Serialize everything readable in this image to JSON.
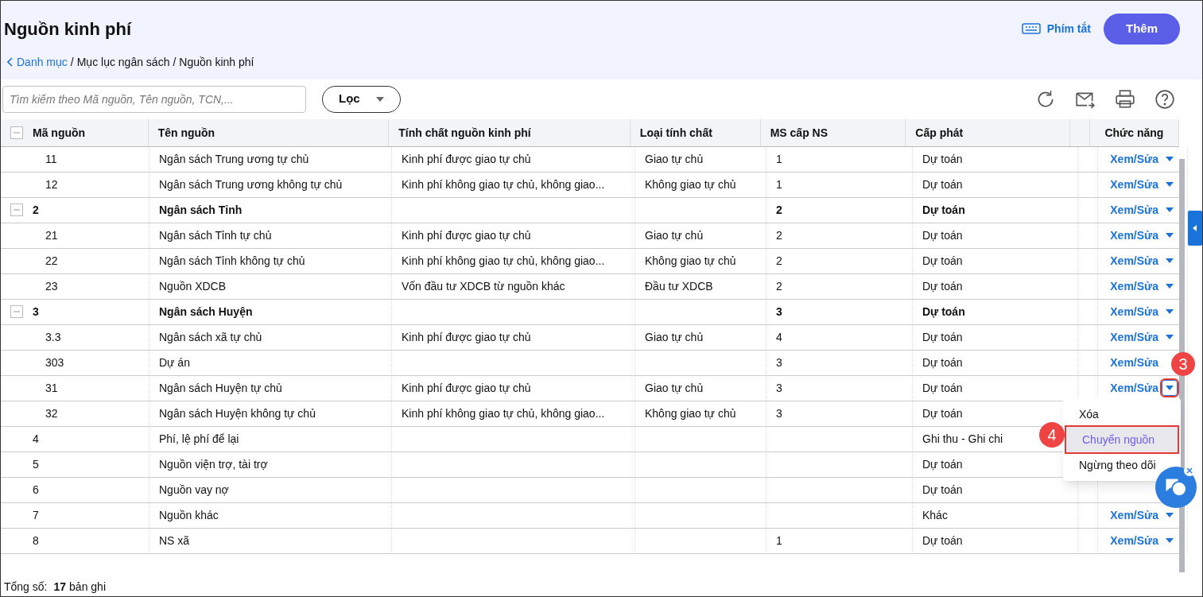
{
  "header": {
    "title": "Nguồn kinh phí",
    "shortcut": "Phím tắt",
    "add_button": "Thêm"
  },
  "breadcrumb": [
    {
      "label": "Danh mục",
      "kind": "link"
    },
    {
      "label": "/",
      "kind": "separator"
    },
    {
      "label": "Mục lục ngân sách",
      "kind": "text"
    },
    {
      "label": "/",
      "kind": "separator"
    },
    {
      "label": "Nguồn kinh phí",
      "kind": "text"
    }
  ],
  "toolbar": {
    "search_placeholder": "Tìm kiếm theo Mã nguồn, Tên nguồn, TCN,...",
    "filter": "Lọc"
  },
  "table": {
    "columns": [
      "Mã nguồn",
      "Tên nguồn",
      "Tính chất nguồn kinh phí",
      "Loại tính chất",
      "MS cấp NS",
      "Cấp phát",
      "Chức năng"
    ],
    "rows": [
      {
        "kind": "child",
        "cells": [
          "11",
          "Ngân sách Trung ương tự chủ",
          "Kinh phí được giao tự chủ",
          "Giao tự chủ",
          "1",
          "Dự toán"
        ],
        "action": "Xem/Sửa",
        "highlighted": false
      },
      {
        "kind": "child",
        "cells": [
          "12",
          "Ngân sách Trung ương không tự chủ",
          "Kinh phí không giao tự chủ, không giao...",
          "Không giao tự chủ",
          "1",
          "Dự toán"
        ],
        "action": "Xem/Sửa",
        "highlighted": false
      },
      {
        "kind": "group",
        "cells": [
          "2",
          "Ngân sách Tỉnh",
          "",
          "",
          "2",
          "Dự toán"
        ],
        "action": "Xem/Sửa",
        "highlighted": false
      },
      {
        "kind": "child",
        "cells": [
          "21",
          "Ngân sách Tỉnh tự chủ",
          "Kinh phí được giao tự chủ",
          "Giao tự chủ",
          "2",
          "Dự toán"
        ],
        "action": "Xem/Sửa",
        "highlighted": false
      },
      {
        "kind": "child",
        "cells": [
          "22",
          "Ngân sách Tỉnh không tự chủ",
          "Kinh phí không giao tự chủ, không giao...",
          "Không giao tự chủ",
          "2",
          "Dự toán"
        ],
        "action": "Xem/Sửa",
        "highlighted": false
      },
      {
        "kind": "child",
        "cells": [
          "23",
          "Nguồn XDCB",
          "Vốn đầu tư XDCB từ nguồn khác",
          "Đầu tư XDCB",
          "2",
          "Dự toán"
        ],
        "action": "Xem/Sửa",
        "highlighted": false
      },
      {
        "kind": "group",
        "cells": [
          "3",
          "Ngân sách Huyện",
          "",
          "",
          "3",
          "Dự toán"
        ],
        "action": "Xem/Sửa",
        "highlighted": false
      },
      {
        "kind": "child",
        "cells": [
          "3.3",
          "Ngân sách xã tự chủ",
          "Kinh phí được giao tự chủ",
          "Giao tự chủ",
          "4",
          "Dự toán"
        ],
        "action": "Xem/Sửa",
        "highlighted": false
      },
      {
        "kind": "child",
        "cells": [
          "303",
          "Dự án",
          "",
          "",
          "3",
          "Dự toán"
        ],
        "action": "Xem/Sửa"
      },
      {
        "kind": "child",
        "cells": [
          "31",
          "Ngân sách Huyện tự chủ",
          "Kinh phí được giao tự chủ",
          "Giao tự chủ",
          "3",
          "Dự toán"
        ],
        "action": "Xem/Sửa",
        "highlighted": true
      },
      {
        "kind": "child",
        "cells": [
          "32",
          "Ngân sách Huyện không tự chủ",
          "Kinh phí không giao tự chủ, không giao...",
          "Không giao tự chủ",
          "3",
          "Dự toán"
        ]
      },
      {
        "kind": "item",
        "cells": [
          "4",
          "Phí, lệ phí để lại",
          "",
          "",
          "",
          "Ghi thu - Ghi chi"
        ]
      },
      {
        "kind": "item",
        "cells": [
          "5",
          "Nguồn viện trợ, tài trợ",
          "",
          "",
          "",
          "Dự toán"
        ]
      },
      {
        "kind": "item",
        "cells": [
          "6",
          "Nguồn vay nợ",
          "",
          "",
          "",
          "Dự toán"
        ]
      },
      {
        "kind": "item",
        "cells": [
          "7",
          "Nguồn khác",
          "",
          "",
          "",
          "Khác"
        ],
        "action": "Xem/Sửa",
        "highlighted": false
      },
      {
        "kind": "item",
        "cells": [
          "8",
          "NS xã",
          "",
          "",
          "1",
          "Dự toán"
        ],
        "action": "Xem/Sửa",
        "highlighted": false
      }
    ]
  },
  "menu": {
    "items": [
      {
        "label": "Xóa",
        "selected": false
      },
      {
        "label": "Chuyển nguồn",
        "selected": true
      },
      {
        "label": "Ngừng theo dõi",
        "selected": false
      }
    ]
  },
  "callouts": [
    "3",
    "4"
  ],
  "footer": {
    "label": "Tổng số:",
    "count": "17",
    "unit": "bản ghi"
  }
}
